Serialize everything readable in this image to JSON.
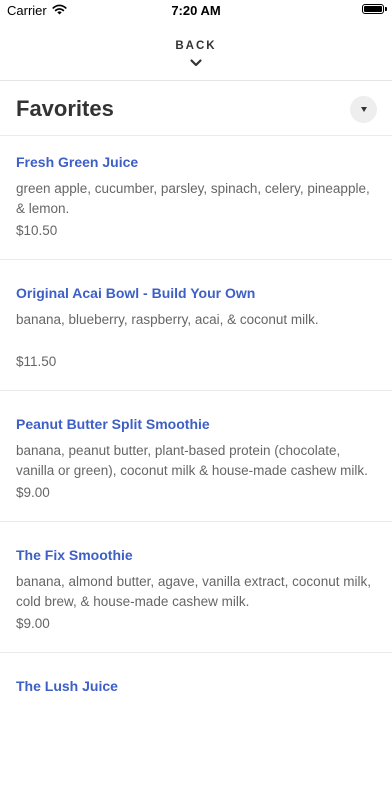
{
  "status_bar": {
    "carrier": "Carrier",
    "time": "7:20 AM",
    "wifi_icon": "wifi-icon",
    "battery_icon": "battery-icon"
  },
  "header": {
    "back_label": "BACK",
    "back_icon": "chevron-down-icon"
  },
  "section": {
    "title": "Favorites",
    "toggle_icon": "caret-down-icon"
  },
  "colors": {
    "item_name": "#3d5fc6",
    "text_secondary": "#666666",
    "title": "#333333"
  },
  "items": [
    {
      "name": "Fresh Green Juice",
      "description": "green apple, cucumber, parsley, spinach, celery, pineapple, & lemon.",
      "price": "$10.50"
    },
    {
      "name": "Original Acai Bowl - Build Your Own",
      "description": "banana, blueberry, raspberry, acai, & coconut milk.",
      "price": "$11.50"
    },
    {
      "name": "Peanut Butter Split Smoothie",
      "description": "banana, peanut butter, plant-based protein (chocolate, vanilla or green), coconut milk & house-made cashew milk.",
      "price": "$9.00"
    },
    {
      "name": "The Fix Smoothie",
      "description": "banana, almond butter, agave, vanilla extract, coconut milk, cold brew, & house-made cashew milk.",
      "price": "$9.00"
    },
    {
      "name": "The Lush Juice",
      "description": "",
      "price": ""
    }
  ]
}
